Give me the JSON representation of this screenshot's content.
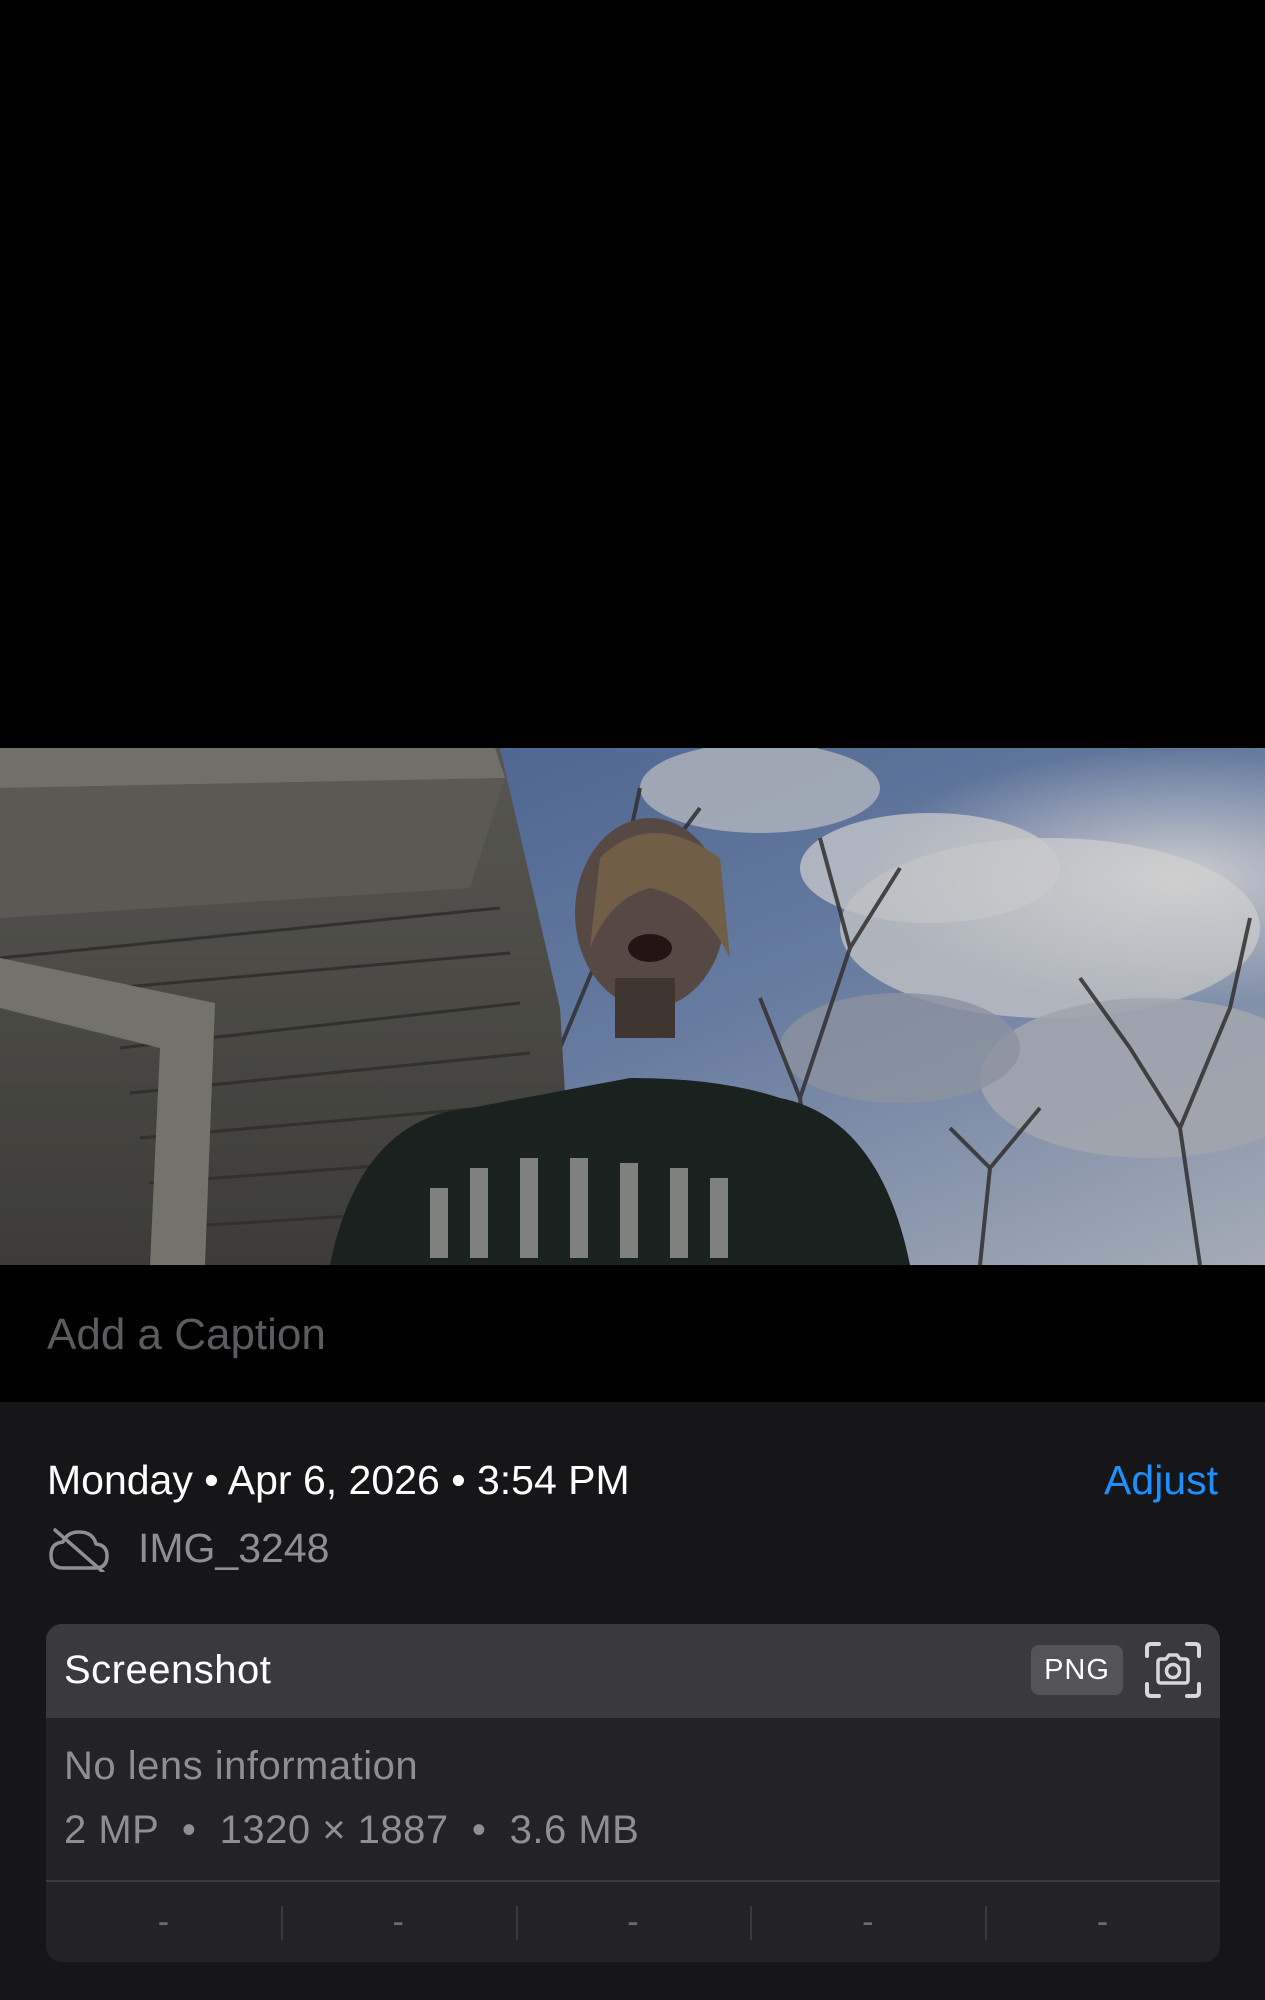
{
  "caption": {
    "placeholder": "Add a Caption"
  },
  "info": {
    "day": "Monday",
    "date": "Apr 6, 2026",
    "time": "3:54 PM",
    "separator": "•",
    "adjust_label": "Adjust",
    "file_name": "IMG_3248",
    "cloud_icon": "cloud-off-icon"
  },
  "metadata": {
    "title": "Screenshot",
    "format": "PNG",
    "camera_icon": "screenshot-camera-icon",
    "lens": "No lens information",
    "megapixels": "2 MP",
    "dimensions": "1320 × 1887",
    "size": "3.6 MB",
    "exif": [
      "-",
      "-",
      "-",
      "-",
      "-"
    ]
  },
  "colors": {
    "accent": "#1e8fff",
    "panel_bg": "#161618",
    "card_bg": "#232326",
    "card_header_bg": "#3a3a3e"
  }
}
